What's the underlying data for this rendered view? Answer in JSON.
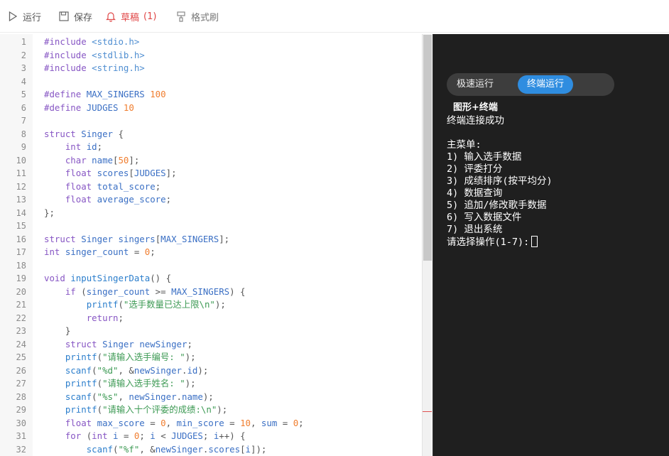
{
  "toolbar": {
    "run_label": "运行",
    "save_label": "保存",
    "draft_label": "草稿",
    "draft_count": "(1)",
    "format_label": "格式刷",
    "draft_color": "#e04848"
  },
  "editor": {
    "lines": [
      {
        "n": "1",
        "code": "#include <stdio.h>"
      },
      {
        "n": "2",
        "code": "#include <stdlib.h>"
      },
      {
        "n": "3",
        "code": "#include <string.h>"
      },
      {
        "n": "4",
        "code": ""
      },
      {
        "n": "5",
        "code": "#define MAX_SINGERS 100"
      },
      {
        "n": "6",
        "code": "#define JUDGES 10"
      },
      {
        "n": "7",
        "code": ""
      },
      {
        "n": "8",
        "code": "struct Singer {"
      },
      {
        "n": "9",
        "code": "    int id;"
      },
      {
        "n": "10",
        "code": "    char name[50];"
      },
      {
        "n": "11",
        "code": "    float scores[JUDGES];"
      },
      {
        "n": "12",
        "code": "    float total_score;"
      },
      {
        "n": "13",
        "code": "    float average_score;"
      },
      {
        "n": "14",
        "code": "};"
      },
      {
        "n": "15",
        "code": ""
      },
      {
        "n": "16",
        "code": "struct Singer singers[MAX_SINGERS];"
      },
      {
        "n": "17",
        "code": "int singer_count = 0;"
      },
      {
        "n": "18",
        "code": ""
      },
      {
        "n": "19",
        "code": "void inputSingerData() {"
      },
      {
        "n": "20",
        "code": "    if (singer_count >= MAX_SINGERS) {"
      },
      {
        "n": "21",
        "code": "        printf(\"选手数量已达上限\\n\");"
      },
      {
        "n": "22",
        "code": "        return;"
      },
      {
        "n": "23",
        "code": "    }"
      },
      {
        "n": "24",
        "code": "    struct Singer newSinger;"
      },
      {
        "n": "25",
        "code": "    printf(\"请输入选手编号: \");"
      },
      {
        "n": "26",
        "code": "    scanf(\"%d\", &newSinger.id);"
      },
      {
        "n": "27",
        "code": "    printf(\"请输入选手姓名: \");"
      },
      {
        "n": "28",
        "code": "    scanf(\"%s\", newSinger.name);"
      },
      {
        "n": "29",
        "code": "    printf(\"请输入十个评委的成绩:\\n\");"
      },
      {
        "n": "30",
        "code": "    float max_score = 0, min_score = 10, sum = 0;"
      },
      {
        "n": "31",
        "code": "    for (int i = 0; i < JUDGES; i++) {"
      },
      {
        "n": "32",
        "code": "        scanf(\"%f\", &newSinger.scores[i]);"
      }
    ]
  },
  "terminal": {
    "mode_fast": "极速运行",
    "mode_terminal": "终端运行",
    "mode_graphic": "图形+终端",
    "connected": "终端连接成功",
    "menu_title": "主菜单:",
    "menu_items": [
      "1) 输入选手数据",
      "2) 评委打分",
      "3) 成绩排序(按平均分)",
      "4) 数据查询",
      "5) 追加/修改歌手数据",
      "6) 写入数据文件",
      "7) 退出系统"
    ],
    "prompt": "请选择操作(1-7):",
    "accent_color": "#2f8de0"
  }
}
